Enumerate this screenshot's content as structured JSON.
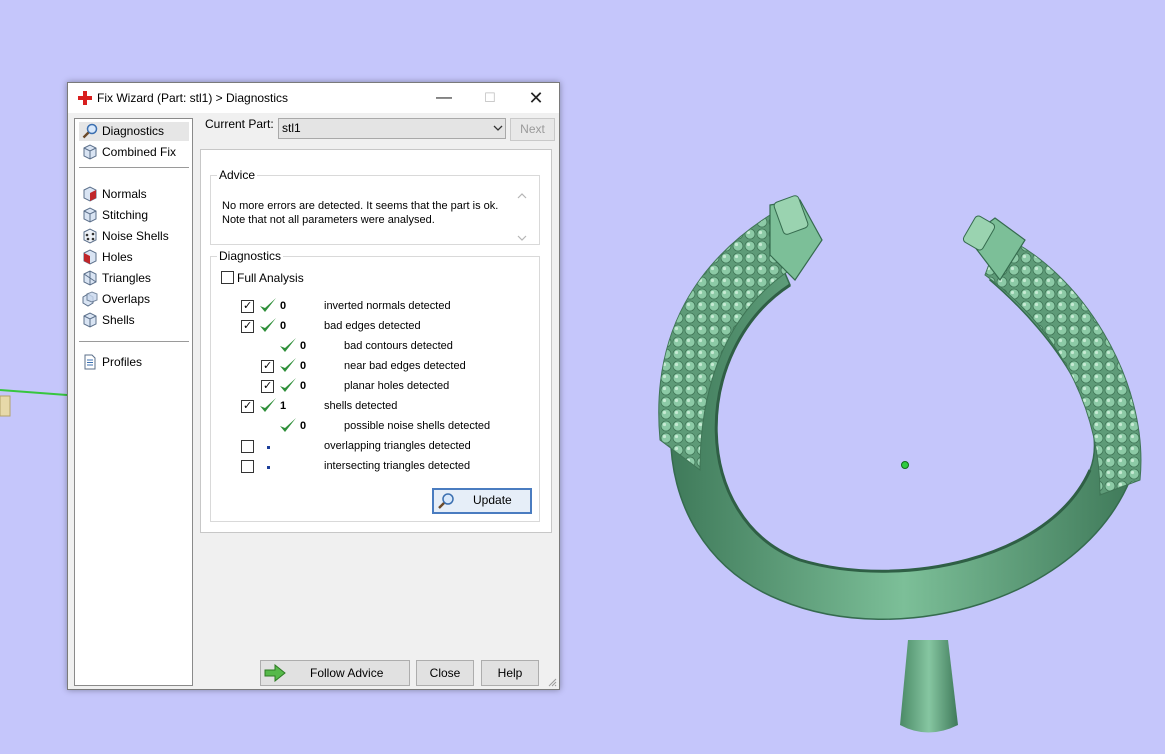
{
  "window": {
    "title": "Fix Wizard (Part: stl1) > Diagnostics",
    "minimize_glyph": "—",
    "maximize_glyph": "☐",
    "close_glyph": "✕"
  },
  "sidebar": {
    "items": [
      {
        "label": "Diagnostics",
        "icon": "magnifier-icon",
        "selected": true
      },
      {
        "label": "Combined Fix",
        "icon": "cube-icon"
      },
      {
        "label": "Normals",
        "icon": "cube-red-face-icon"
      },
      {
        "label": "Stitching",
        "icon": "cube-icon"
      },
      {
        "label": "Noise Shells",
        "icon": "dotted-cube-icon"
      },
      {
        "label": "Holes",
        "icon": "cube-red-face-icon"
      },
      {
        "label": "Triangles",
        "icon": "cube-icon"
      },
      {
        "label": "Overlaps",
        "icon": "overlap-shells-icon"
      },
      {
        "label": "Shells",
        "icon": "cube-icon"
      },
      {
        "label": "Profiles",
        "icon": "document-icon"
      }
    ]
  },
  "part": {
    "label": "Current Part:",
    "value": "stl1",
    "next_label": "Next"
  },
  "advice": {
    "title": "Advice",
    "line1": "No more errors are detected. It seems that the part is ok.",
    "line2": "Note that not all parameters were analysed."
  },
  "diagnostics": {
    "title": "Diagnostics",
    "full_analysis_label": "Full Analysis",
    "rows": [
      {
        "checkbox": true,
        "checked": true,
        "status": "ok",
        "count": "0",
        "label": "inverted normals detected"
      },
      {
        "checkbox": true,
        "checked": true,
        "status": "ok",
        "count": "0",
        "label": "bad edges detected"
      },
      {
        "checkbox": false,
        "status": "ok",
        "count": "0",
        "label": "bad contours detected"
      },
      {
        "checkbox": true,
        "checked": true,
        "status": "ok",
        "count": "0",
        "label": "near bad edges detected"
      },
      {
        "checkbox": true,
        "checked": true,
        "status": "ok",
        "count": "0",
        "label": "planar holes detected"
      },
      {
        "checkbox": true,
        "checked": true,
        "status": "ok",
        "count": "1",
        "label": "shells detected"
      },
      {
        "checkbox": false,
        "status": "ok",
        "count": "0",
        "label": "possible noise shells detected"
      },
      {
        "checkbox": true,
        "checked": false,
        "status": "not-analysed",
        "count": "",
        "label": "overlapping triangles detected"
      },
      {
        "checkbox": true,
        "checked": false,
        "status": "not-analysed",
        "count": "",
        "label": "intersecting triangles detected"
      }
    ],
    "update_label": "Update"
  },
  "footer": {
    "follow_advice_label": "Follow Advice",
    "close_label": "Close",
    "help_label": "Help"
  },
  "colors": {
    "viewport_bg": "#c5c6fb",
    "model_green": "#6fae8a",
    "check_green": "#2f8f3a",
    "accent_blue": "#4a7cc0"
  }
}
